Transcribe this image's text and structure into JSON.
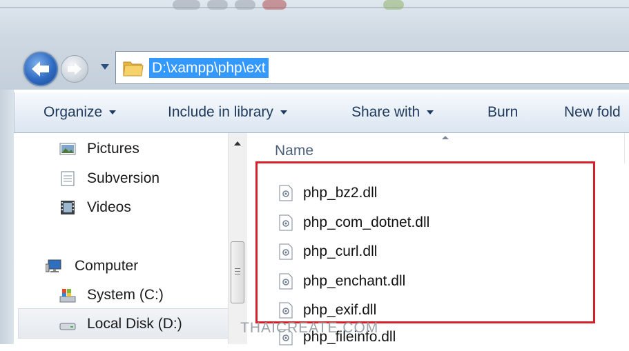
{
  "address_bar": {
    "path": "D:\\xampp\\php\\ext"
  },
  "toolbar": {
    "organize": "Organize",
    "include_in_library": "Include in library",
    "share_with": "Share with",
    "burn": "Burn",
    "new_folder": "New fold"
  },
  "nav_pane": {
    "items": [
      {
        "label": "Pictures",
        "icon": "pictures-icon"
      },
      {
        "label": "Subversion",
        "icon": "document-icon"
      },
      {
        "label": "Videos",
        "icon": "videos-icon"
      },
      {
        "label": "Computer",
        "icon": "computer-icon"
      },
      {
        "label": "System  (C:)",
        "icon": "system-drive-icon"
      },
      {
        "label": "Local Disk (D:)",
        "icon": "disk-drive-icon",
        "selected": true
      }
    ]
  },
  "file_list": {
    "column_name": "Name",
    "files": [
      "php_bz2.dll",
      "php_com_dotnet.dll",
      "php_curl.dll",
      "php_enchant.dll",
      "php_exif.dll",
      "php_fileinfo.dll"
    ]
  },
  "watermark": "THAICREATE.COM",
  "colors": {
    "highlight_border": "#d42028",
    "address_selection": "#3399ff"
  }
}
